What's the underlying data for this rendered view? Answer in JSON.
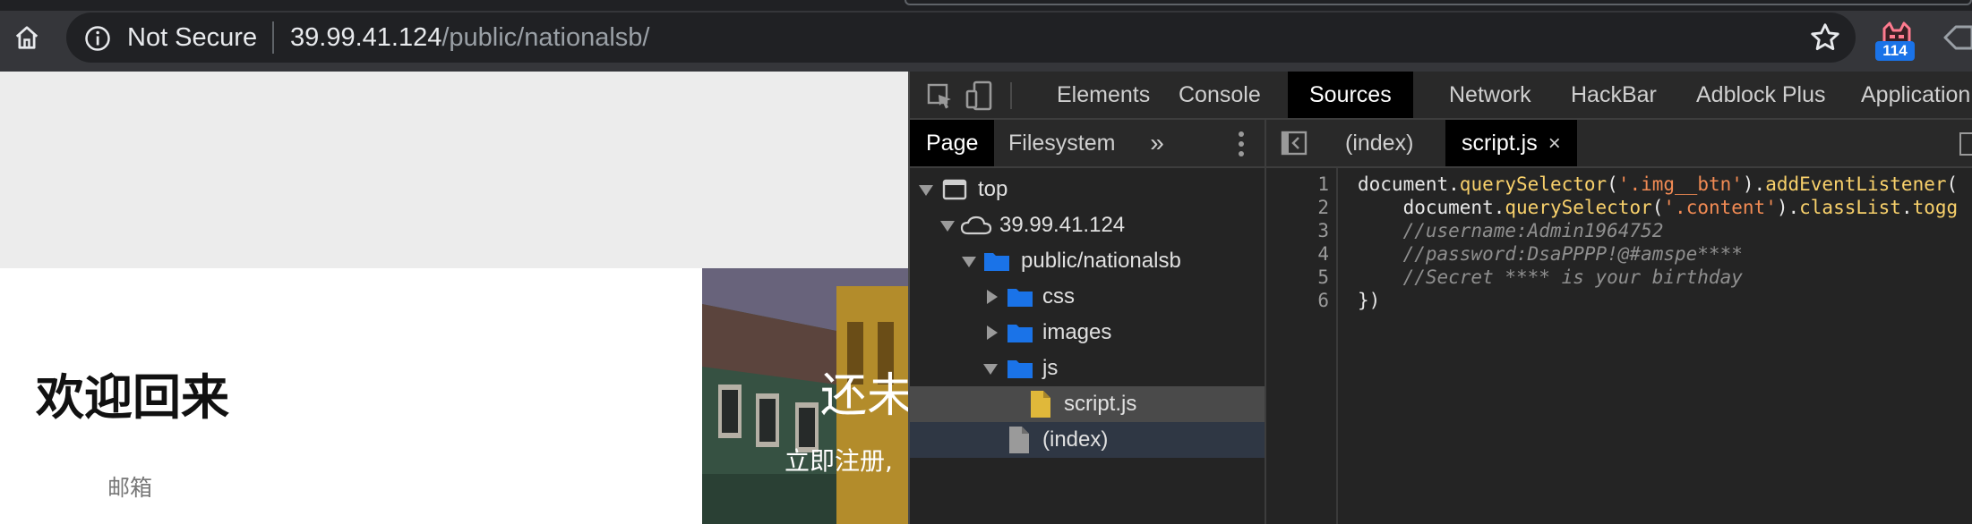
{
  "browser": {
    "security_label": "Not Secure",
    "url_host": "39.99.41.124",
    "url_path": "/public/nationalsb/",
    "extension_badge": "114",
    "icons": [
      "home-icon",
      "info-icon",
      "star-icon",
      "extension-icon"
    ]
  },
  "page": {
    "welcome_heading": "欢迎回来",
    "email_label": "邮箱",
    "hero_title": "还未",
    "hero_subtitle": "立即注册,"
  },
  "devtools": {
    "tabs": [
      {
        "label": "Elements",
        "active": false
      },
      {
        "label": "Console",
        "active": false
      },
      {
        "label": "Sources",
        "active": true
      },
      {
        "label": "Network",
        "active": false
      },
      {
        "label": "HackBar",
        "active": false
      },
      {
        "label": "Adblock Plus",
        "active": false
      },
      {
        "label": "Application",
        "active": false
      }
    ],
    "navigator": {
      "tabs": [
        {
          "label": "Page",
          "active": true
        },
        {
          "label": "Filesystem",
          "active": false
        }
      ],
      "more": "»",
      "tree": [
        {
          "label": "top",
          "type": "frame",
          "expanded": true
        },
        {
          "label": "39.99.41.124",
          "type": "domain",
          "expanded": true
        },
        {
          "label": "public/nationalsb",
          "type": "folder",
          "expanded": true
        },
        {
          "label": "css",
          "type": "folder",
          "expanded": false
        },
        {
          "label": "images",
          "type": "folder",
          "expanded": false
        },
        {
          "label": "js",
          "type": "folder",
          "expanded": true
        },
        {
          "label": "script.js",
          "type": "script",
          "selected": true
        },
        {
          "label": "(index)",
          "type": "document"
        }
      ]
    },
    "editor": {
      "tabs": [
        {
          "label": "(index)",
          "active": false
        },
        {
          "label": "script.js",
          "active": true,
          "close": "×"
        }
      ],
      "line_numbers": [
        "1",
        "2",
        "3",
        "4",
        "5",
        "6"
      ],
      "code": {
        "l1": {
          "a": "document.",
          "b": "querySelector",
          "c": "(",
          "d": "'.img__btn'",
          "e": ").",
          "f": "addEventListener",
          "g": "("
        },
        "l2": {
          "a": "    document.",
          "b": "querySelector",
          "c": "(",
          "d": "'.content'",
          "e": ").",
          "f": "classList",
          "g": ".",
          "h": "togg"
        },
        "l3": "    //username:Admin1964752",
        "l4": "    //password:DsaPPPP!@#amspe****",
        "l5": "    //Secret **** is your birthday",
        "l6": "})"
      }
    }
  },
  "colors": {
    "chrome_bg": "#35363a",
    "omnibox_bg": "#202124",
    "devtools_bg": "#242424",
    "active_tab_bg": "#000000",
    "method": "#f9d16b",
    "string": "#f28b54",
    "comment": "#8f8f8f",
    "folder": "#1a73e8",
    "script_file": "#e0b83a"
  }
}
